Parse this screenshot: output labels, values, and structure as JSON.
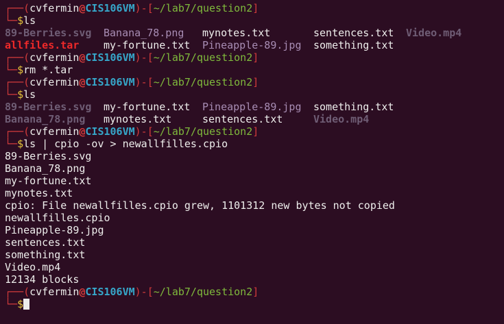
{
  "prompt": {
    "user": "cvfermin",
    "at": "@",
    "host": "CIS106VM",
    "path": "~/lab7/question2",
    "symbol": "$"
  },
  "blocks": {
    "p1_cmd": "ls",
    "ls1_row1": [
      "89-Berries.svg",
      "Banana_78.png",
      "mynotes.txt",
      "sentences.txt",
      "Video.mp4"
    ],
    "ls1_row2": [
      "allfiles.tar",
      "my-fortune.txt",
      "Pineapple-89.jpg",
      "something.txt"
    ],
    "p2_cmd": "rm *.tar",
    "p3_cmd": "ls",
    "ls2_row1": [
      "89-Berries.svg",
      "my-fortune.txt",
      "Pineapple-89.jpg",
      "something.txt"
    ],
    "ls2_row2": [
      "Banana_78.png",
      "mynotes.txt",
      "sentences.txt",
      "Video.mp4"
    ],
    "p4_cmd": "ls | cpio -ov > newallfilles.cpio",
    "output": [
      "89-Berries.svg",
      "Banana_78.png",
      "my-fortune.txt",
      "mynotes.txt",
      "cpio: File newallfilles.cpio grew, 1101312 new bytes not copied",
      "newallfilles.cpio",
      "Pineapple-89.jpg",
      "sentences.txt",
      "something.txt",
      "Video.mp4",
      "12134 blocks"
    ]
  },
  "colors": {
    "background": "#2c0d22",
    "host": "#36a6c9",
    "path": "#7fba3c",
    "prompt_symbol": "#e3c13a",
    "frame": "#d23b3b"
  }
}
